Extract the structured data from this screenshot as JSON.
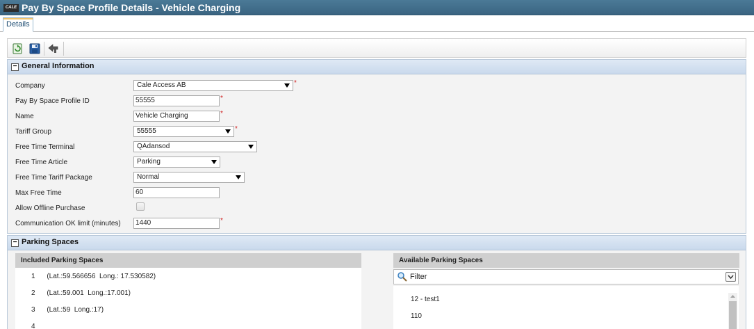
{
  "window": {
    "logo_text": "CALE",
    "title": "Pay By Space Profile Details - Vehicle Charging"
  },
  "tabs": [
    {
      "label": "Details",
      "active": true
    }
  ],
  "toolbar": {
    "buttons": [
      "refresh-save-icon",
      "save-icon",
      "back-icon"
    ]
  },
  "general": {
    "section_title": "General Information",
    "collapse_symbol": "−",
    "required_mark": "*",
    "company": {
      "label": "Company",
      "value": "Cale Access AB"
    },
    "profile_id": {
      "label": "Pay By Space Profile ID",
      "value": "55555"
    },
    "name": {
      "label": "Name",
      "value": "Vehicle Charging"
    },
    "tariff_group": {
      "label": "Tariff Group",
      "value": "55555"
    },
    "free_time_terminal": {
      "label": "Free Time Terminal",
      "value": "QAdansod"
    },
    "free_time_article": {
      "label": "Free Time Article",
      "value": "Parking"
    },
    "free_time_tariff_package": {
      "label": "Free Time Tariff Package",
      "value": "Normal"
    },
    "max_free_time": {
      "label": "Max Free Time",
      "value": "60"
    },
    "allow_offline_purchase": {
      "label": "Allow Offline Purchase",
      "checked": false
    },
    "comm_ok_limit": {
      "label": "Communication OK limit (minutes)",
      "value": "1440"
    }
  },
  "parking": {
    "section_title": "Parking Spaces",
    "collapse_symbol": "−",
    "included": {
      "header": "Included Parking Spaces",
      "items": [
        {
          "num": "1",
          "text": "(Lat.:59.566656  Long.: 17.530582)"
        },
        {
          "num": "2",
          "text": "(Lat.:59.001  Long.:17.001)"
        },
        {
          "num": "3",
          "text": "(Lat.:59  Long.:17)"
        },
        {
          "num": "4",
          "text": ""
        }
      ]
    },
    "available": {
      "header": "Available Parking Spaces",
      "filter_label": "Filter",
      "items": [
        "12 - test1",
        "110"
      ]
    }
  }
}
